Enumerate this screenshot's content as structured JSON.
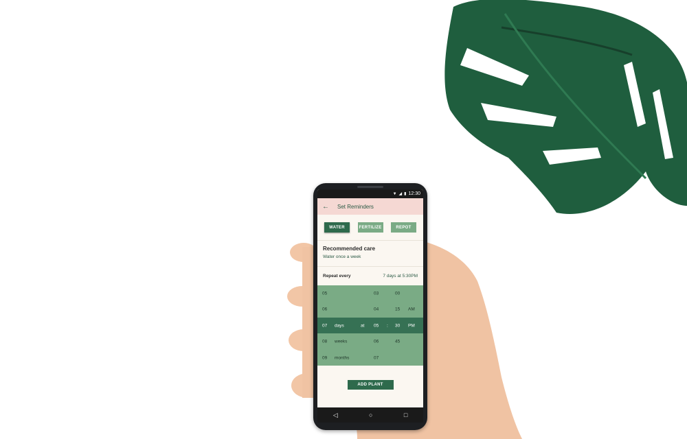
{
  "status_bar": {
    "time": "12:30",
    "icons": [
      "wifi-icon",
      "signal-icon",
      "battery-icon"
    ]
  },
  "app_bar": {
    "title": "Set Reminders",
    "back_icon": "arrow-left-icon"
  },
  "tabs": [
    {
      "label": "WATER",
      "active": true
    },
    {
      "label": "FERTILIZE",
      "active": false
    },
    {
      "label": "REPOT",
      "active": false
    }
  ],
  "care": {
    "heading": "Recommended care",
    "subtitle": "Water once a week"
  },
  "repeat": {
    "label": "Repeat every",
    "value": "7 days at 5:30PM"
  },
  "picker": {
    "rows": [
      {
        "num": "05",
        "unit": "",
        "at": "",
        "hour": "03",
        "colon": "",
        "minute": "00",
        "ampm": ""
      },
      {
        "num": "06",
        "unit": "",
        "at": "",
        "hour": "04",
        "colon": "",
        "minute": "15",
        "ampm": "AM"
      },
      {
        "num": "07",
        "unit": "days",
        "at": "at",
        "hour": "05",
        "colon": ":",
        "minute": "30",
        "ampm": "PM"
      },
      {
        "num": "08",
        "unit": "weeks",
        "at": "",
        "hour": "06",
        "colon": "",
        "minute": "45",
        "ampm": ""
      },
      {
        "num": "09",
        "unit": "months",
        "at": "",
        "hour": "07",
        "colon": "",
        "minute": "",
        "ampm": ""
      }
    ],
    "selected_index": 2
  },
  "add_button": {
    "label": "ADD PLANT"
  },
  "nav_bar": {
    "icons": [
      "back-triangle-icon",
      "home-circle-icon",
      "recents-square-icon"
    ]
  },
  "colors": {
    "primary": "#2e6a4c",
    "picker_bg": "#7aab85",
    "app_bar_bg": "#f5d8d3",
    "screen_bg": "#fbf7f1"
  }
}
